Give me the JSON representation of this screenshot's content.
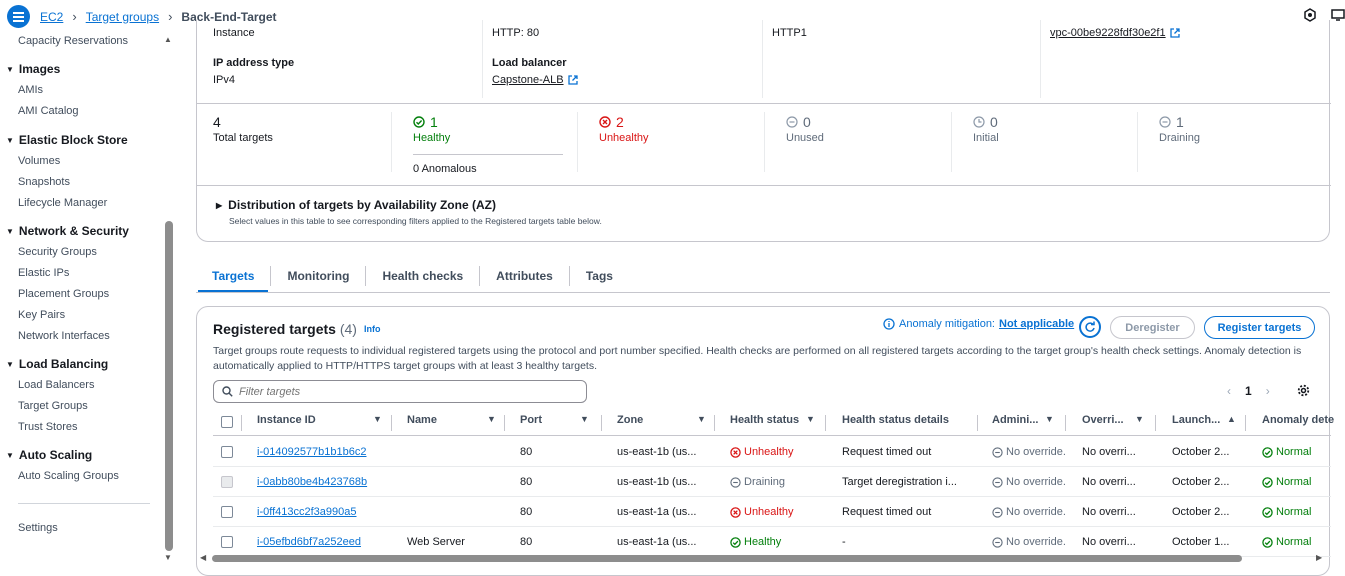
{
  "breadcrumb": {
    "items": [
      "EC2",
      "Target groups"
    ],
    "current": "Back-End-Target"
  },
  "sidebar": {
    "top_item": "Capacity Reservations",
    "sections": [
      {
        "title": "Images",
        "items": [
          "AMIs",
          "AMI Catalog"
        ]
      },
      {
        "title": "Elastic Block Store",
        "items": [
          "Volumes",
          "Snapshots",
          "Lifecycle Manager"
        ]
      },
      {
        "title": "Network & Security",
        "items": [
          "Security Groups",
          "Elastic IPs",
          "Placement Groups",
          "Key Pairs",
          "Network Interfaces"
        ]
      },
      {
        "title": "Load Balancing",
        "items": [
          "Load Balancers",
          "Target Groups",
          "Trust Stores"
        ]
      },
      {
        "title": "Auto Scaling",
        "items": [
          "Auto Scaling Groups"
        ]
      }
    ],
    "settings": "Settings"
  },
  "summary": {
    "target_type_value": "Instance",
    "protocol_port_value": "HTTP: 80",
    "protocol_version_value": "HTTP1",
    "vpc_value": "vpc-00be9228fdf30e2f1",
    "ip_type_label": "IP address type",
    "ip_type_value": "IPv4",
    "lb_label": "Load balancer",
    "lb_value": "Capstone-ALB"
  },
  "stats": {
    "total": {
      "value": "4",
      "label": "Total targets"
    },
    "healthy": {
      "value": "1",
      "label": "Healthy",
      "anomalous": "0 Anomalous"
    },
    "unhealthy": {
      "value": "2",
      "label": "Unhealthy"
    },
    "unused": {
      "value": "0",
      "label": "Unused"
    },
    "initial": {
      "value": "0",
      "label": "Initial"
    },
    "draining": {
      "value": "1",
      "label": "Draining"
    }
  },
  "distribution": {
    "title": "Distribution of targets by Availability Zone (AZ)",
    "desc": "Select values in this table to see corresponding filters applied to the Registered targets table below."
  },
  "tabs": [
    "Targets",
    "Monitoring",
    "Health checks",
    "Attributes",
    "Tags"
  ],
  "registered": {
    "title": "Registered targets",
    "count": "(4)",
    "info": "Info",
    "anomaly_label": "Anomaly mitigation:",
    "anomaly_value": "Not applicable",
    "deregister": "Deregister",
    "register": "Register targets",
    "desc": "Target groups route requests to individual registered targets using the protocol and port number specified. Health checks are performed on all registered targets according to the target group's health check settings. Anomaly detection is automatically applied to HTTP/HTTPS target groups with at least 3 healthy targets.",
    "filter_placeholder": "Filter targets",
    "page": "1"
  },
  "table": {
    "columns": [
      "Instance ID",
      "Name",
      "Port",
      "Zone",
      "Health status",
      "Health status details",
      "Admini...",
      "Overri...",
      "Launch...",
      "Anomaly dete"
    ],
    "rows": [
      {
        "id": "i-014092577b1b1b6c2",
        "name": "",
        "port": "80",
        "zone": "us-east-1b (us...",
        "health": "Unhealthy",
        "details": "Request timed out",
        "admin": "No override.",
        "override": "No overri...",
        "launch": "October 2...",
        "anomaly": "Normal"
      },
      {
        "id": "i-0abb80be4b423768b",
        "name": "",
        "port": "80",
        "zone": "us-east-1b (us...",
        "health": "Draining",
        "details": "Target deregistration i...",
        "admin": "No override.",
        "override": "No overri...",
        "launch": "October 2...",
        "anomaly": "Normal"
      },
      {
        "id": "i-0ff413cc2f3a990a5",
        "name": "",
        "port": "80",
        "zone": "us-east-1a (us...",
        "health": "Unhealthy",
        "details": "Request timed out",
        "admin": "No override.",
        "override": "No overri...",
        "launch": "October 2...",
        "anomaly": "Normal"
      },
      {
        "id": "i-05efbd6bf7a252eed",
        "name": "Web Server",
        "port": "80",
        "zone": "us-east-1a (us...",
        "health": "Healthy",
        "details": "-",
        "admin": "No override.",
        "override": "No overri...",
        "launch": "October 1...",
        "anomaly": "Normal"
      }
    ]
  },
  "colors": {
    "link": "#0972d3",
    "healthy": "#037f0c",
    "unhealthy": "#d91515",
    "muted": "#5f6b7a"
  }
}
